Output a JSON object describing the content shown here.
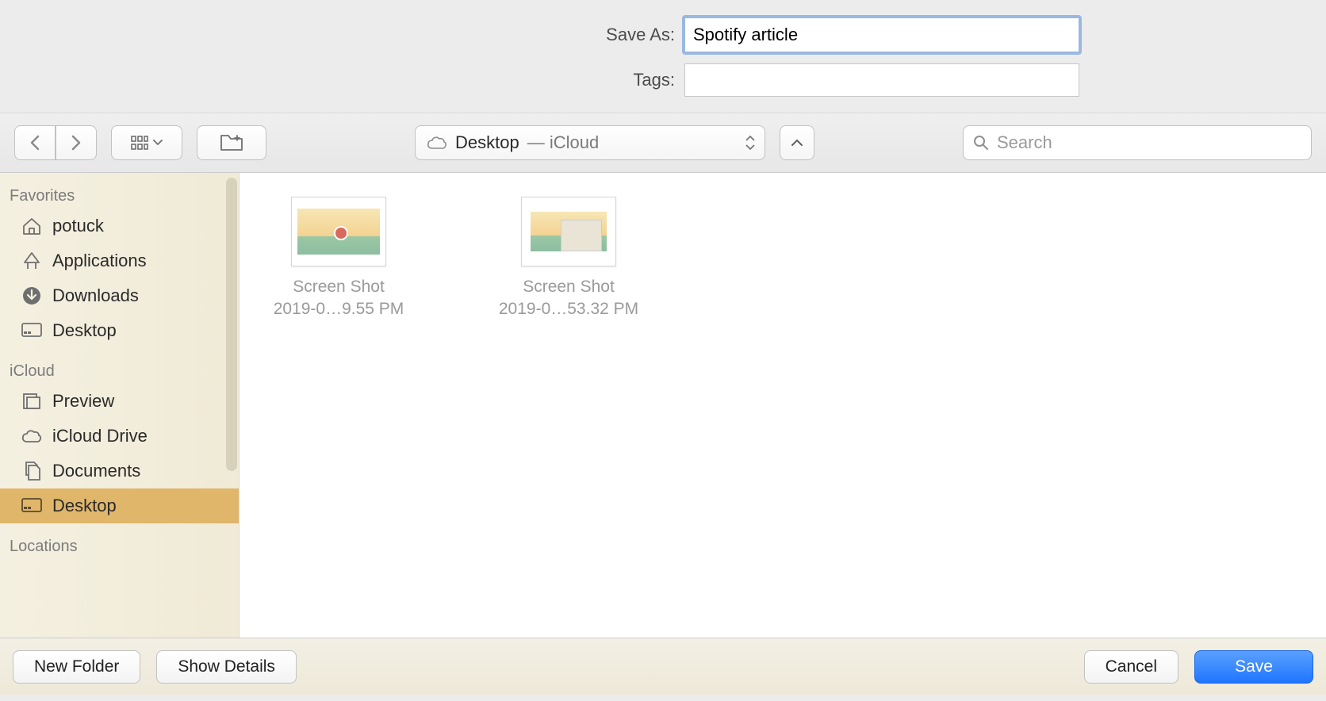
{
  "form": {
    "save_as_label": "Save As:",
    "save_as_value": "Spotify article",
    "tags_label": "Tags:",
    "tags_value": ""
  },
  "toolbar": {
    "location_main": "Desktop",
    "location_sub": " — iCloud",
    "search_placeholder": "Search"
  },
  "sidebar": {
    "sections": [
      {
        "title": "Favorites",
        "items": [
          {
            "icon": "home-icon",
            "label": "potuck",
            "selected": false
          },
          {
            "icon": "applications-icon",
            "label": "Applications",
            "selected": false
          },
          {
            "icon": "downloads-icon",
            "label": "Downloads",
            "selected": false
          },
          {
            "icon": "desktop-icon",
            "label": "Desktop",
            "selected": false
          }
        ]
      },
      {
        "title": "iCloud",
        "items": [
          {
            "icon": "preview-icon",
            "label": "Preview",
            "selected": false
          },
          {
            "icon": "cloud-icon",
            "label": "iCloud Drive",
            "selected": false
          },
          {
            "icon": "documents-icon",
            "label": "Documents",
            "selected": false
          },
          {
            "icon": "desktop-icon",
            "label": "Desktop",
            "selected": true
          }
        ]
      },
      {
        "title": "Locations",
        "items": []
      }
    ]
  },
  "files": [
    {
      "name_l1": "Screen Shot",
      "name_l2": "2019-0…9.55 PM"
    },
    {
      "name_l1": "Screen Shot",
      "name_l2": "2019-0…53.32 PM"
    }
  ],
  "footer": {
    "new_folder": "New Folder",
    "show_details": "Show Details",
    "cancel": "Cancel",
    "save": "Save"
  }
}
